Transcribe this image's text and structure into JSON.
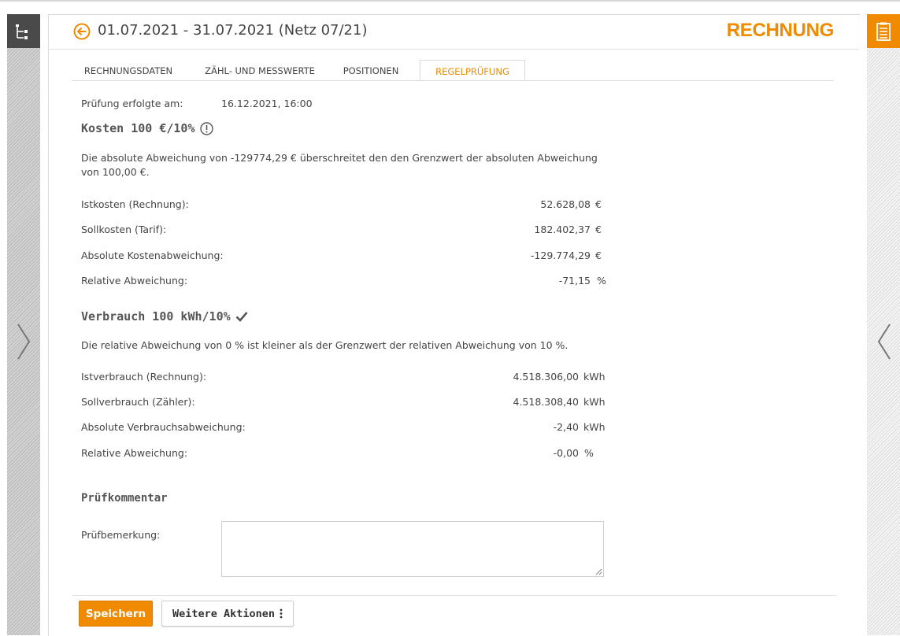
{
  "header": {
    "title": "01.07.2021 - 31.07.2021 (Netz 07/21)",
    "doc_type": "RECHNUNG"
  },
  "tabs": [
    {
      "label": "RECHNUNGSDATEN"
    },
    {
      "label": "ZÄHL- UND MESSWERTE"
    },
    {
      "label": "POSITIONEN"
    },
    {
      "label": "REGELPRÜFUNG"
    }
  ],
  "active_tab": "REGELPRÜFUNG",
  "check": {
    "date_label": "Prüfung erfolgte am:",
    "date_value": "16.12.2021, 16:00"
  },
  "kosten": {
    "title": "Kosten 100 €/10%",
    "status_icon": "warning-circle-icon",
    "message": "Die absolute Abweichung von -129774,29 € überschreitet den den Grenzwert der absoluten Abweichung von 100,00 €.",
    "rows": [
      {
        "label": "Istkosten (Rechnung):",
        "value": "52.628,08",
        "unit": "€"
      },
      {
        "label": "Sollkosten (Tarif):",
        "value": "182.402,37",
        "unit": "€"
      },
      {
        "label": "Absolute Kostenabweichung:",
        "value": "-129.774,29",
        "unit": "€"
      },
      {
        "label": "Relative Abweichung:",
        "value": "-71,15",
        "unit": "%"
      }
    ]
  },
  "verbrauch": {
    "title": "Verbrauch 100 kWh/10%",
    "status_icon": "checkmark-icon",
    "message": "Die relative Abweichung von 0 % ist kleiner als der Grenzwert der relativen Abweichung von 10 %.",
    "rows": [
      {
        "label": "Istverbrauch (Rechnung):",
        "value": "4.518.306,00",
        "unit": "kWh"
      },
      {
        "label": "Sollverbrauch (Zähler):",
        "value": "4.518.308,40",
        "unit": "kWh"
      },
      {
        "label": "Absolute Verbrauchsabweichung:",
        "value": "-2,40",
        "unit": "kWh"
      },
      {
        "label": "Relative Abweichung:",
        "value": "-0,00",
        "unit": "%"
      }
    ]
  },
  "comment": {
    "heading": "Prüfkommentar",
    "label": "Prüfbemerkung:",
    "value": ""
  },
  "buttons": {
    "save": "Speichern",
    "more": "Weitere Aktionen"
  },
  "colors": {
    "accent": "#f08a00",
    "dark_panel": "#4a4a4a",
    "text": "#444444"
  }
}
